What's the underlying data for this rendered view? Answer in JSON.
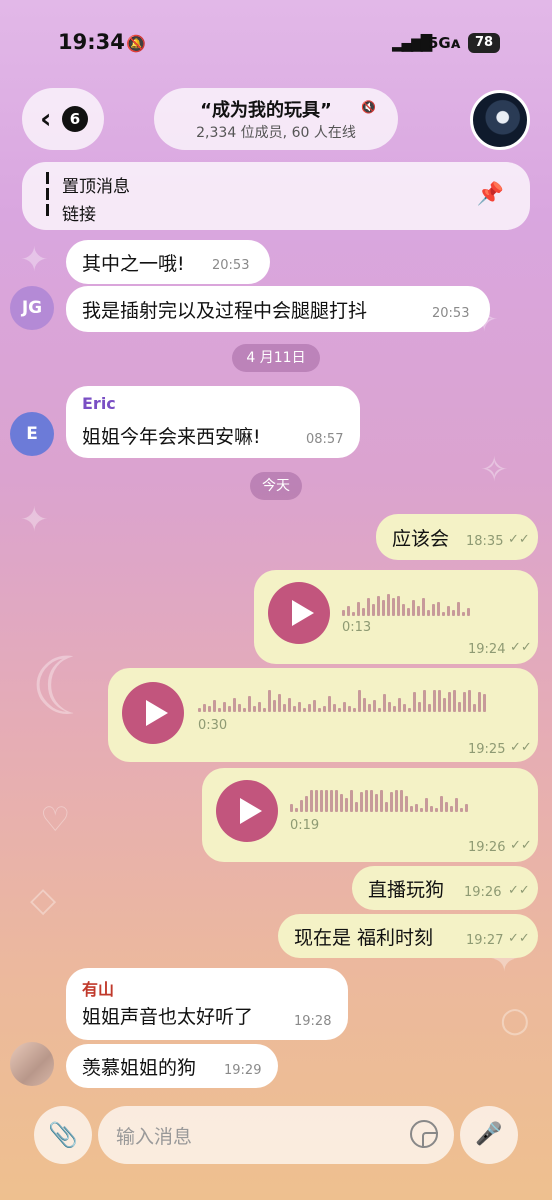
{
  "status": {
    "time": "19:34",
    "network": "5Gᴀ",
    "battery": "78"
  },
  "header": {
    "back_count": "6",
    "title": "“成为我的玩具”",
    "subtitle": "2,334 位成员, 60 人在线"
  },
  "pinned": {
    "title": "置顶消息",
    "text": "链接"
  },
  "messages": {
    "m1": {
      "text": "其中之一哦!",
      "time": "20:53"
    },
    "m2": {
      "avatar": "JG",
      "text": "我是插射完以及过程中会腿腿打抖",
      "time": "20:53"
    },
    "date1": "4 月11日",
    "m3": {
      "avatar": "E",
      "sender": "Eric",
      "text": "姐姐今年会来西安嘛!",
      "time": "08:57"
    },
    "date2": "今天",
    "m4": {
      "text": "应该会",
      "time": "18:35"
    },
    "v1": {
      "duration": "0:13",
      "time": "19:24"
    },
    "v2": {
      "duration": "0:30",
      "time": "19:25"
    },
    "v3": {
      "duration": "0:19",
      "time": "19:26"
    },
    "m5": {
      "text": "直播玩狗",
      "time": "19:26"
    },
    "m6": {
      "text": "现在是 福利时刻",
      "time": "19:27"
    },
    "m7": {
      "sender": "有山",
      "text": "姐姐声音也太好听了",
      "time": "19:28"
    },
    "m8": {
      "text": "羡慕姐姐的狗",
      "time": "19:29"
    }
  },
  "input": {
    "placeholder": "输入消息"
  },
  "colors": {
    "sender_eric": "#7a4fc4",
    "sender_youshan": "#c0392b",
    "avatar_jg": "#b48ad6",
    "avatar_e": "#6c7bd8",
    "play": "#c2557d"
  }
}
